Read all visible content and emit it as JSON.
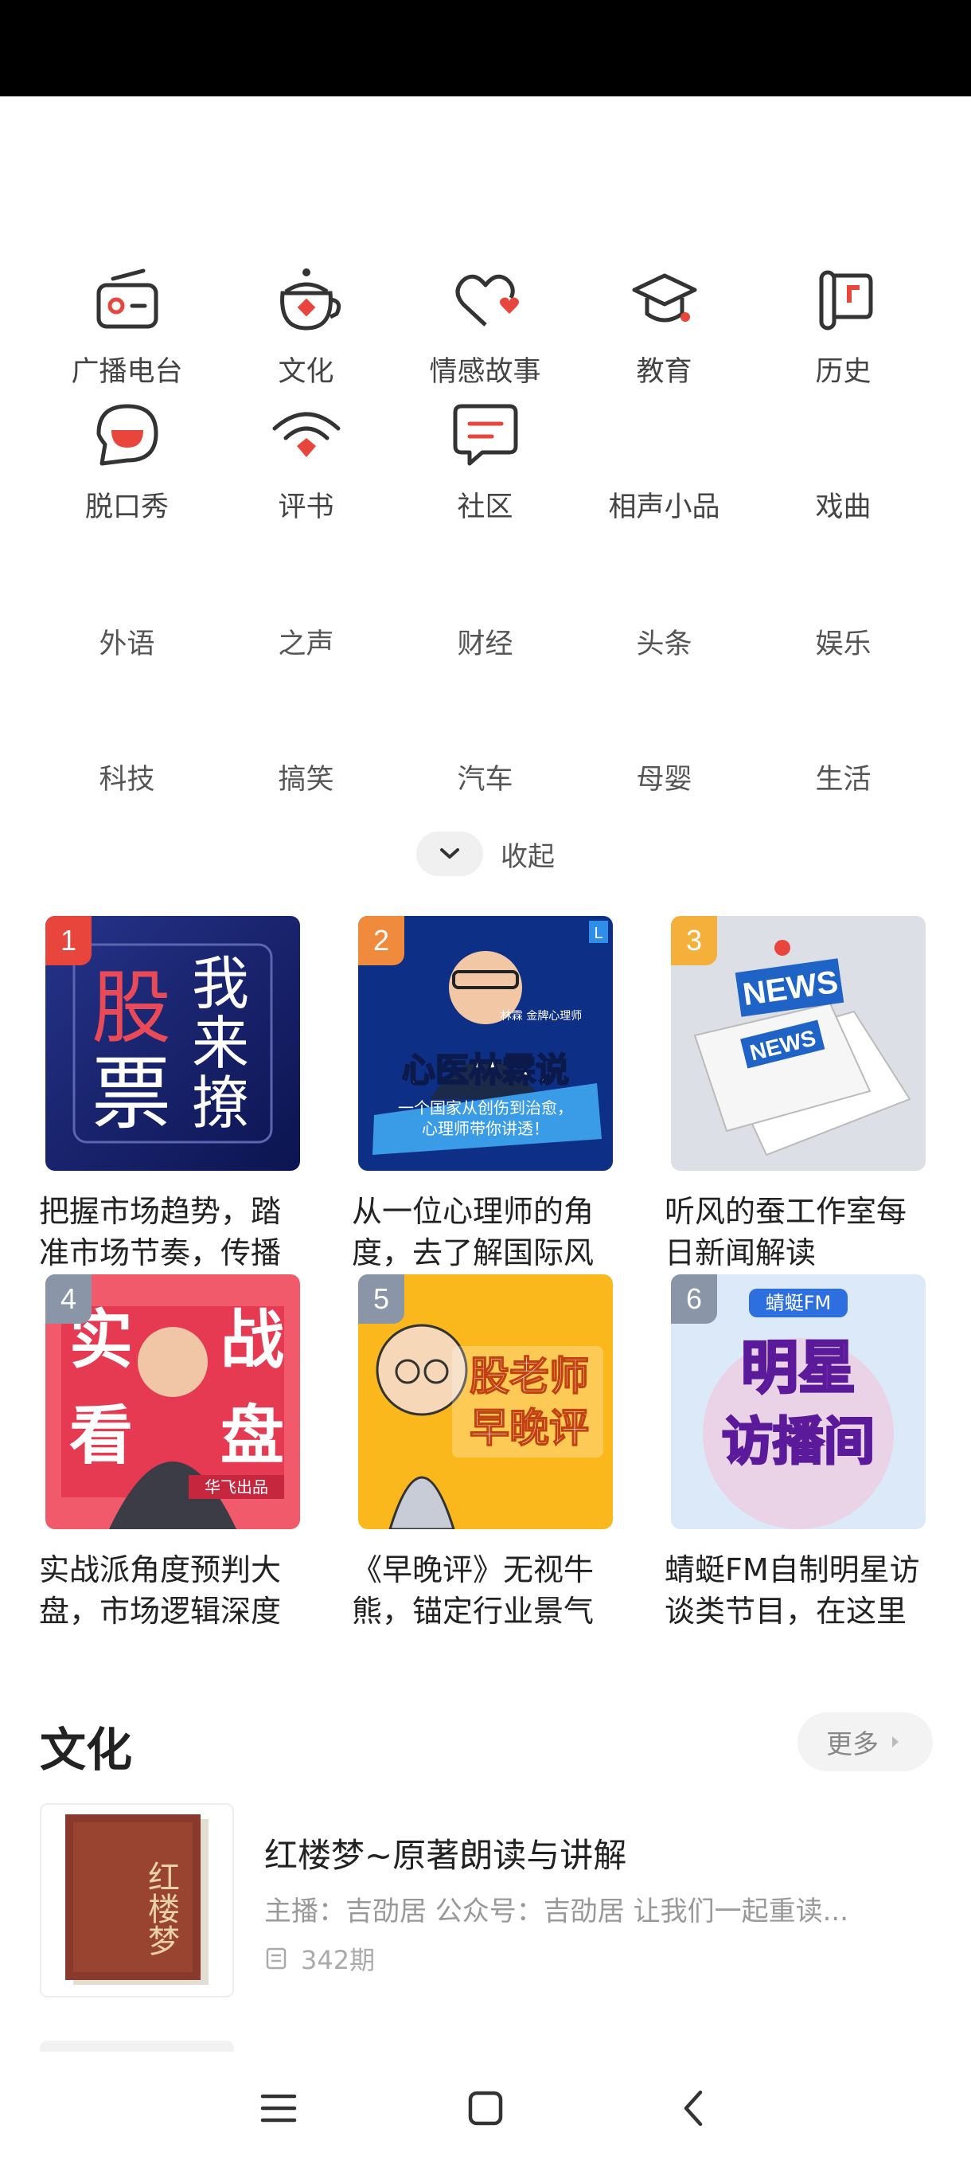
{
  "categories_row1": [
    {
      "label": "广播电台",
      "icon": "radio-icon"
    },
    {
      "label": "文化",
      "icon": "teapot-icon"
    },
    {
      "label": "情感故事",
      "icon": "heart-chat-icon"
    },
    {
      "label": "教育",
      "icon": "graduation-cap-icon"
    },
    {
      "label": "历史",
      "icon": "scroll-icon"
    }
  ],
  "categories_row2": [
    {
      "label": "脱口秀",
      "icon": "mouth-bubble-icon"
    },
    {
      "label": "评书",
      "icon": "wifi-fan-icon"
    },
    {
      "label": "社区",
      "icon": "chat-lines-icon"
    },
    {
      "label": "相声小品"
    },
    {
      "label": "戏曲"
    }
  ],
  "categories_row3": [
    "外语",
    "之声",
    "财经",
    "头条",
    "娱乐"
  ],
  "categories_row4": [
    "科技",
    "搞笑",
    "汽车",
    "母婴",
    "生活"
  ],
  "collapse_label": "收起",
  "ranking": [
    {
      "rank": "1",
      "title": "把握市场趋势，踏准市场节奏，传播",
      "cover_text": [
        "股",
        "票",
        "我",
        "来",
        "撩"
      ],
      "badge_color": "#e8453c"
    },
    {
      "rank": "2",
      "title": "从一位心理师的角度，去了解国际风",
      "cover_text": [
        "心医林霖说",
        "一个国家从创伤到治愈，",
        "心理师带你讲透！",
        "林霖 金牌心理师",
        "L"
      ],
      "badge_color": "#f08a3c"
    },
    {
      "rank": "3",
      "title": "听风的蚕工作室每日新闻解读",
      "cover_text": [
        "NEWS",
        "NEWS"
      ],
      "badge_color": "#f4b03a"
    },
    {
      "rank": "4",
      "title": "实战派角度预判大盘，市场逻辑深度",
      "cover_text": [
        "实",
        "战",
        "看",
        "盘",
        "华飞出品"
      ],
      "badge_color": "#8a95a8"
    },
    {
      "rank": "5",
      "title": "《早晚评》无视牛熊，锚定行业景气",
      "cover_text": [
        "股老师",
        "早晚评"
      ],
      "badge_color": "#8a95a8"
    },
    {
      "rank": "6",
      "title": "蜻蜓FM自制明星访谈类节目，在这里",
      "cover_text": [
        "蜻蜓FM",
        "明星",
        "访播间"
      ],
      "badge_color": "#8a95a8"
    }
  ],
  "section": {
    "title": "文化",
    "more": "更多"
  },
  "album": {
    "title": "红楼梦~原著朗读与讲解",
    "desc": "主播：吉劭居 公众号：吉劭居 让我们一起重读...",
    "count": "342期",
    "cover_text": "红楼梦"
  }
}
